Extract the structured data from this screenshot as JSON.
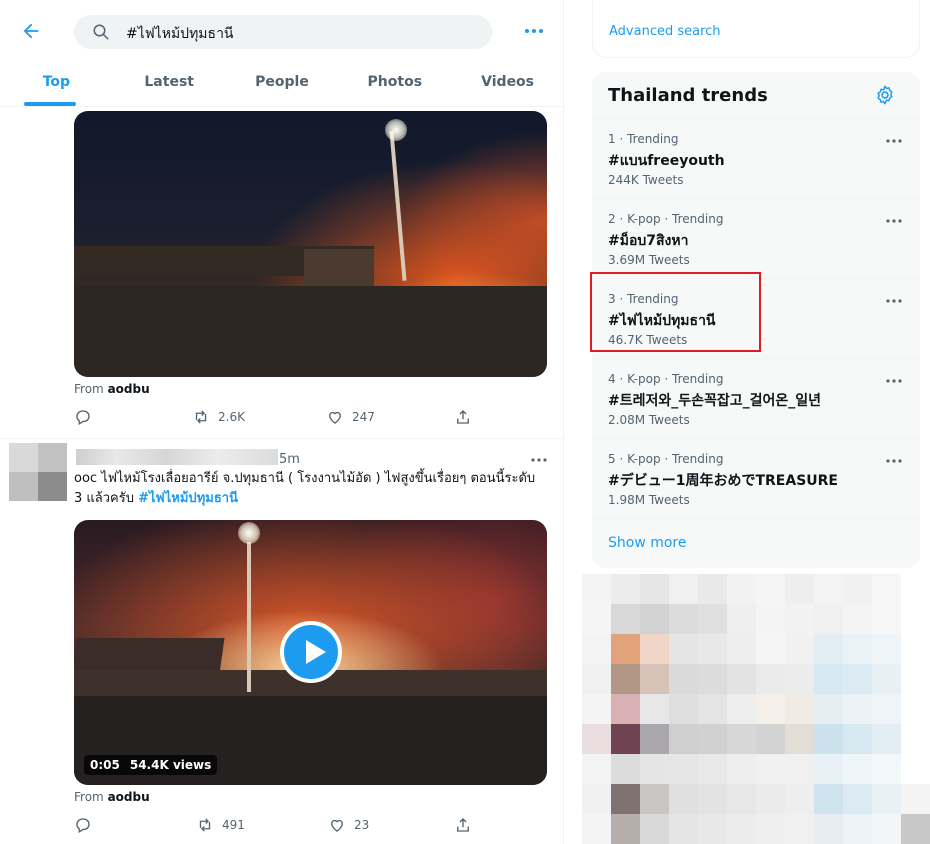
{
  "search": {
    "query": "#ไฟไหม้ปทุมธานี"
  },
  "tabs": [
    "Top",
    "Latest",
    "People",
    "Photos",
    "Videos"
  ],
  "tweet1": {
    "from_prefix": "From",
    "from_user": "aodbu",
    "retweets": "2.6K",
    "likes": "247"
  },
  "tweet2": {
    "time_fragment": "5m",
    "text_start": "ooc ไฟไหม้โรงเลื่อยอารีย์ จ.ปทุมธานี ( โรงงานไม้อัด ) ไฟสูงขึ้นเรื่อยๆ ตอนนี้ระดับ 3 แล้วครับ ",
    "hashtag": "#ไฟไหม้ปทุมธานี",
    "video_duration": "0:05",
    "video_views": "54.4K views",
    "from_prefix": "From",
    "from_user": "aodbu",
    "retweets": "491",
    "likes": "23"
  },
  "sidebar": {
    "advanced_search": "Advanced search",
    "trends_title": "Thailand trends",
    "trends": [
      {
        "meta": "1 · Trending",
        "name": "#แบนfreeyouth",
        "count": "244K Tweets"
      },
      {
        "meta": "2 · K-pop · Trending",
        "name": "#ม็อบ7สิงหา",
        "count": "3.69M Tweets"
      },
      {
        "meta": "3 · Trending",
        "name": "#ไฟไหม้ปทุมธานี",
        "count": "46.7K Tweets"
      },
      {
        "meta": "4 · K-pop · Trending",
        "name": "#트레저와_두손꼭잡고_걸어온_일년",
        "count": "2.08M Tweets"
      },
      {
        "meta": "5 · K-pop · Trending",
        "name": "#デビュー1周年おめでTREASURE",
        "count": "1.98M Tweets"
      }
    ],
    "show_more": "Show more"
  },
  "colors": {
    "accent": "#1d9bf0",
    "highlight": "#e01b24",
    "muted_text": "#536471"
  }
}
